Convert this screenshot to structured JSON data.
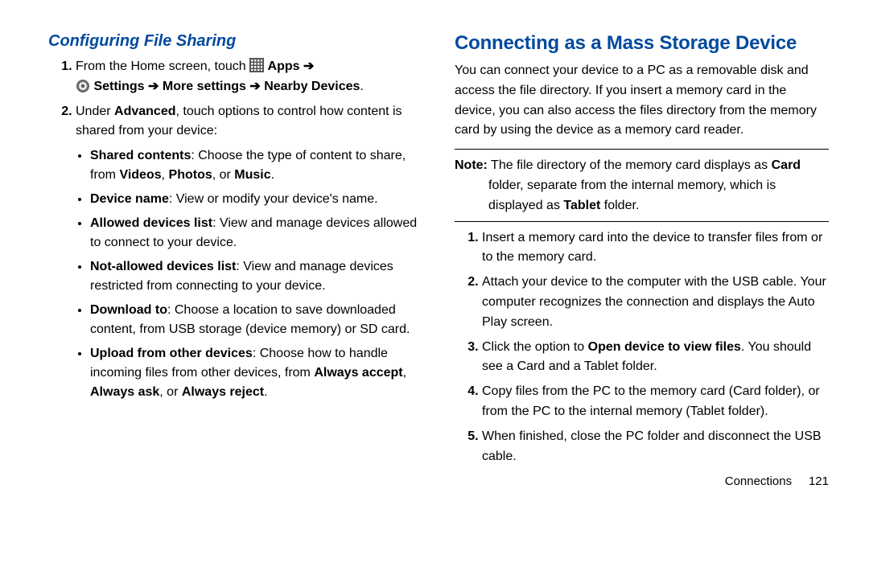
{
  "left": {
    "title": "Configuring File Sharing",
    "step1_a": "From the Home screen, touch ",
    "step1_apps": "Apps",
    "step1_arrow": " ➔",
    "step1_b1": "Settings",
    "step1_b2": "More settings",
    "step1_b3": "Nearby Devices",
    "step1_period": ".",
    "step2_a": "Under ",
    "step2_b": "Advanced",
    "step2_c": ", touch options to control how content is shared from your device:",
    "bul1_a": "Shared contents",
    "bul1_b": ": Choose the type of content to share, from ",
    "bul1_c": "Videos",
    "bul1_d": ", ",
    "bul1_e": "Photos",
    "bul1_f": ", or ",
    "bul1_g": "Music",
    "bul1_h": ".",
    "bul2_a": "Device name",
    "bul2_b": ": View or modify your device's name.",
    "bul3_a": "Allowed devices list",
    "bul3_b": ": View and manage devices allowed to connect to your device.",
    "bul4_a": "Not-allowed devices list",
    "bul4_b": ": View and manage devices restricted from connecting to your device.",
    "bul5_a": "Download to",
    "bul5_b": ": Choose a location to save downloaded content, from USB storage (device memory) or SD card.",
    "bul6_a": "Upload from other devices",
    "bul6_b": ": Choose how to handle incoming files from other devices, from ",
    "bul6_c": "Always accept",
    "bul6_d": ", ",
    "bul6_e": "Always ask",
    "bul6_f": ", or ",
    "bul6_g": "Always reject",
    "bul6_h": "."
  },
  "right": {
    "title": "Connecting as a Mass Storage Device",
    "intro": "You can connect your device to a PC as a removable disk and access the file directory. If you insert a memory card in the device, you can also access the files directory from the memory card by using the device as a memory card reader.",
    "note_label": "Note:",
    "note_a": " The file directory of the memory card displays as ",
    "note_b": "Card",
    "note_c": " folder, separate from the internal memory, which is displayed as ",
    "note_d": "Tablet",
    "note_e": " folder.",
    "s1": "Insert a memory card into the device to transfer files from or to the memory card.",
    "s2": "Attach your device to the computer with the USB cable. Your computer recognizes the connection and displays the Auto Play screen.",
    "s3_a": "Click the option to ",
    "s3_b": "Open device to view files",
    "s3_c": ". You should see a Card and a Tablet folder.",
    "s4": "Copy files from the PC to the memory card (Card folder), or from the PC to the internal memory (Tablet folder).",
    "s5": "When finished, close the PC folder and disconnect the USB cable.",
    "footer_section": "Connections",
    "footer_page": "121"
  }
}
